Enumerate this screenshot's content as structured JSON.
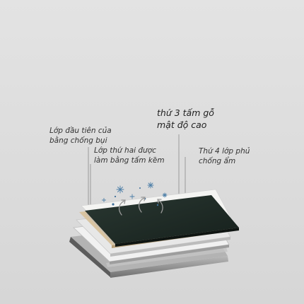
{
  "layers": {
    "layer1": {
      "line1": "Lớp đầu tiên của",
      "line2": "bằng chống bụi"
    },
    "layer2": {
      "line1": "Lớp thứ hai được",
      "line2": "làm bằng tấm kẽm"
    },
    "layer3": {
      "line1": "thứ 3 tấm gỗ",
      "line2": "mật độ cao"
    },
    "layer4": {
      "line1": "Thứ 4 lớp phủ",
      "line2": "chống ẩm"
    }
  },
  "colors": {
    "background": "#dedede",
    "top_board": "#1f2b26",
    "wood_layer": "#d8c3a0",
    "zinc_layer": "#e9e9e9",
    "frame": "#8d8d8d"
  },
  "icons": [
    "dust-particle-icon",
    "airflow-arrow-icon"
  ]
}
